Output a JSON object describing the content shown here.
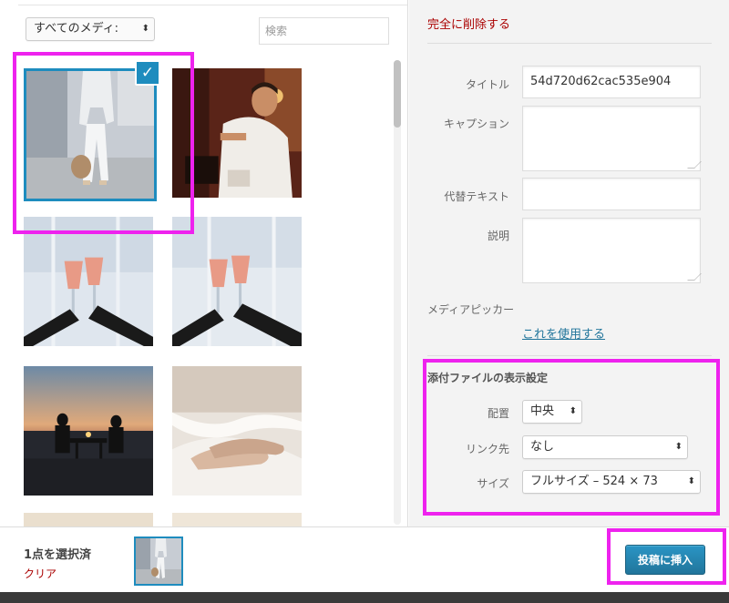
{
  "filter": {
    "selected": "すべてのメディ:",
    "arrows": "⬍"
  },
  "search": {
    "placeholder": "検索"
  },
  "grid": {
    "items": [
      {
        "alt": "woman-white-outfit",
        "selected": true
      },
      {
        "alt": "man-pouring-wine"
      },
      {
        "alt": "champagne-toast-1"
      },
      {
        "alt": "champagne-toast-2"
      },
      {
        "alt": "beach-dinner-couple"
      },
      {
        "alt": "feet-in-bed"
      }
    ],
    "check_glyph": "✓"
  },
  "details": {
    "delete_link": "完全に削除する",
    "title_label": "タイトル",
    "title_value": "54d720d62cac535e904",
    "caption_label": "キャプション",
    "caption_value": "",
    "alt_label": "代替テキスト",
    "alt_value": "",
    "description_label": "説明",
    "description_value": "",
    "media_picker_label": "メディアピッカー",
    "use_this_link": "これを使用する"
  },
  "display_settings": {
    "heading": "添付ファイルの表示設定",
    "align_label": "配置",
    "align_value": "中央",
    "link_label": "リンク先",
    "link_value": "なし",
    "size_label": "サイズ",
    "size_value": "フルサイズ – 524 × 73",
    "arrows": "⬍"
  },
  "toolbar": {
    "selection_count": "1点を選択済",
    "clear_link": "クリア",
    "insert_button": "投稿に挿入"
  },
  "colors": {
    "accent": "#1e8cbe",
    "highlight": "#ee22ee",
    "danger": "#aa0000",
    "link": "#21759b"
  }
}
